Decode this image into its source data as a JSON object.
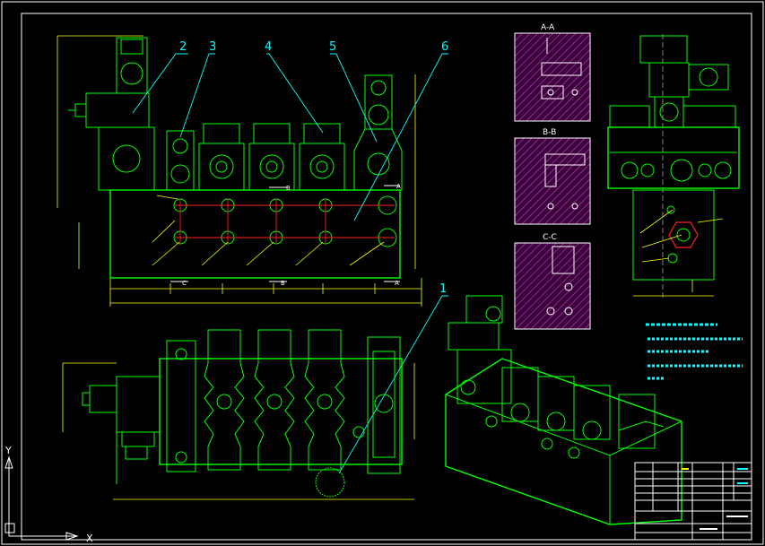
{
  "balloons": [
    "2",
    "3",
    "4",
    "5",
    "6",
    "1"
  ],
  "sections": {
    "aa": "A-A",
    "bb": "B-B",
    "cc": "C-C"
  },
  "section_marks": {
    "a": "A",
    "b": "B",
    "c": "C"
  },
  "axes": {
    "x": "X",
    "y": "Y"
  },
  "colors": {
    "outline": "#00ff00",
    "dimension": "#ffff00",
    "leader": "#00ffff",
    "centerline": "#ff2020",
    "hatch": "#cc44cc"
  }
}
